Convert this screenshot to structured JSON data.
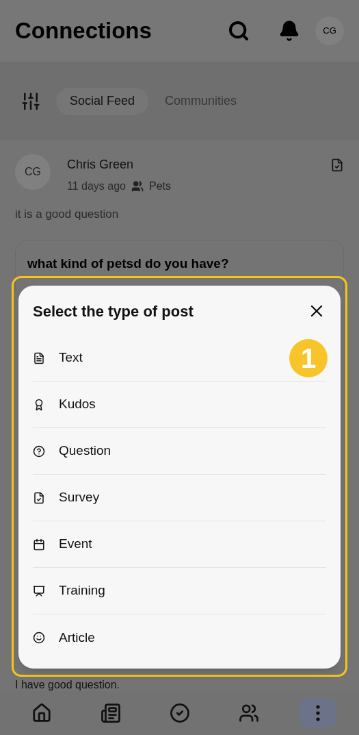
{
  "header": {
    "title": "Connections",
    "avatar": "CG"
  },
  "tabs": [
    {
      "label": "Social Feed",
      "selected": true
    },
    {
      "label": "Communities",
      "selected": false
    }
  ],
  "post": {
    "avatar": "CG",
    "author": "Chris Green",
    "time": "11 days ago",
    "community": "Pets",
    "text": "it is a good question",
    "question": "what kind of petsd do you have?"
  },
  "reply_text": "I have good question.",
  "modal": {
    "title": "Select the type of post",
    "badge": "1",
    "options": [
      {
        "label": "Text",
        "kind": "text"
      },
      {
        "label": "Kudos",
        "kind": "kudos"
      },
      {
        "label": "Question",
        "kind": "question"
      },
      {
        "label": "Survey",
        "kind": "survey"
      },
      {
        "label": "Event",
        "kind": "event"
      },
      {
        "label": "Training",
        "kind": "training"
      },
      {
        "label": "Article",
        "kind": "article"
      }
    ]
  },
  "nav": [
    {
      "kind": "home",
      "selected": false
    },
    {
      "kind": "news",
      "selected": false
    },
    {
      "kind": "tasks",
      "selected": false
    },
    {
      "kind": "people",
      "selected": false
    },
    {
      "kind": "more",
      "selected": true
    }
  ]
}
